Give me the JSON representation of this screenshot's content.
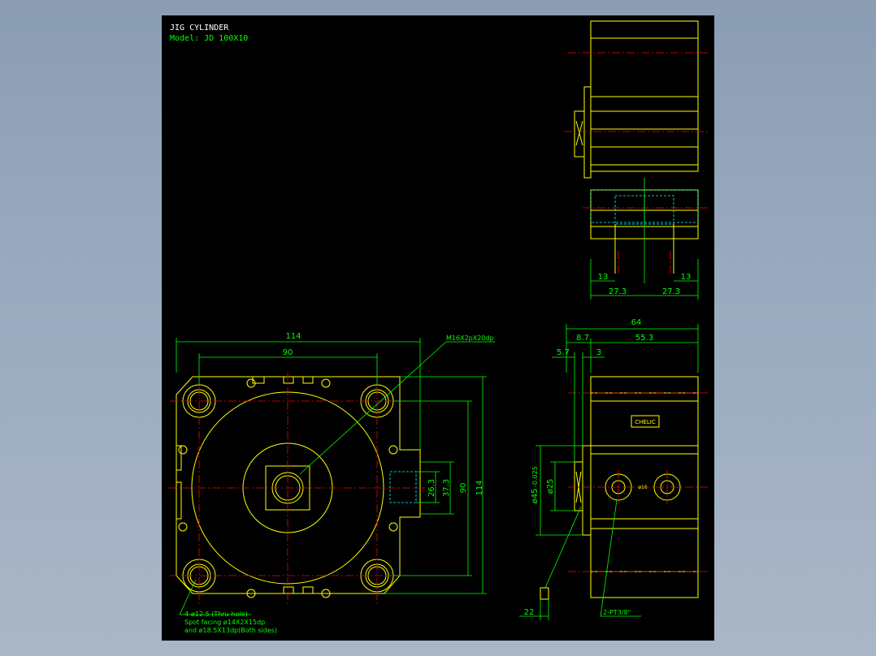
{
  "title": {
    "line1": "JIG CYLINDER",
    "line2": "Model: JD 100X10"
  },
  "colors": {
    "background": "#000000",
    "outline": "#ffff00",
    "dimension": "#00ff00",
    "centerline": "#ff0000",
    "hidden": "#00ffff",
    "title_line1": "#ffffff",
    "title_line2": "#00ff00"
  },
  "front_view": {
    "dim_width_overall": "114",
    "dim_width_holes": "90",
    "dim_height_overall": "114",
    "dim_height_holes": "90",
    "dim_port_outer": "37.3",
    "dim_port_inner": "26.3",
    "callout_thread": "M16X2pX20dp",
    "note_line1": "4-ø12.5 (Thru-hole)",
    "note_line2": "Spot facing  ø14X2X15dp",
    "note_line3": "and ø18.5X13dp(Both sides)"
  },
  "side_view": {
    "dim_total_length": "64",
    "dim_rod_section": "8.7",
    "dim_body_length": "55.3",
    "dim_rod_protrusion": "5.7",
    "dim_flange": "3",
    "dim_rod_diameter": "ø45",
    "dim_rod_tolerance": "-0.025",
    "dim_bore": "ø25",
    "dim_rod_end": "22",
    "port_label": "2-PT3/8\"",
    "label_plate": "CHELIC",
    "port_mark": "ø16"
  },
  "top_view": {
    "dim_left_port_offset": "13",
    "dim_right_port_offset": "13",
    "dim_left_half": "27.3",
    "dim_right_half": "27.3"
  }
}
